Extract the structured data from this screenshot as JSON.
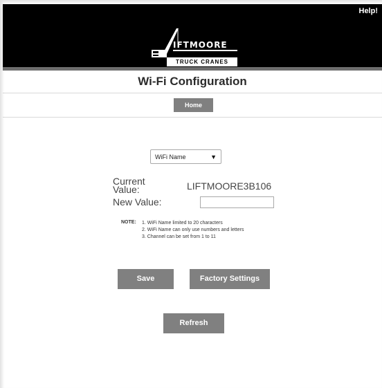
{
  "header": {
    "help_label": "Help!",
    "logo_word": "IFTMOORE",
    "logo_sub": "TRUCK CRANES"
  },
  "page_title": "Wi-Fi Configuration",
  "nav": {
    "home_label": "Home"
  },
  "form": {
    "select_value": "WiFi Name",
    "current_label": "Current Value:",
    "current_value": "LIFTMOORE3B106",
    "new_label": "New Value:",
    "new_value": "",
    "note_label": "NOTE:",
    "notes": [
      "1. WiFi Name limited to 20 characters",
      "2. WiFi Name can only use numbers and letters",
      "3. Channel can be set from 1 to 11"
    ]
  },
  "buttons": {
    "save": "Save",
    "factory": "Factory Settings",
    "refresh": "Refresh"
  },
  "colors": {
    "header_bg": "#000000",
    "button_bg": "#808080",
    "button_text": "#ffffff"
  }
}
